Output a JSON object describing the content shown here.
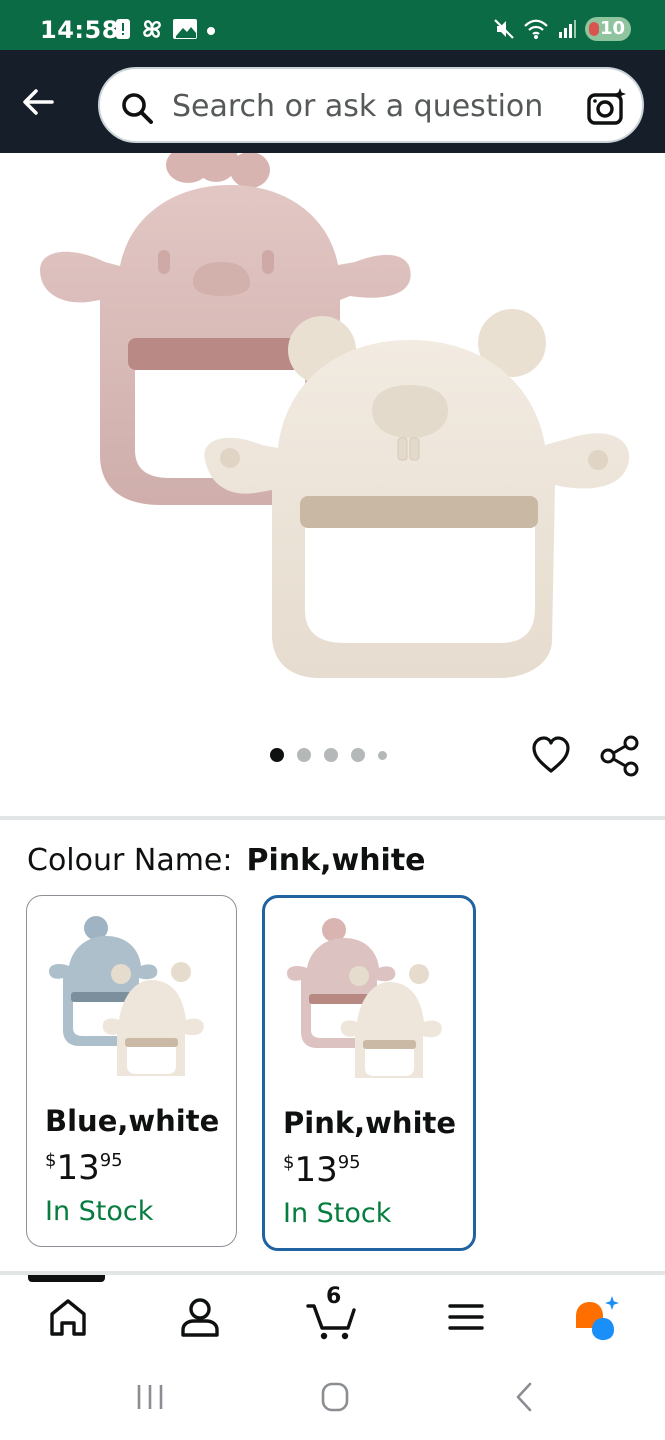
{
  "status_bar": {
    "time": "14:58",
    "battery": "10"
  },
  "search": {
    "placeholder": "Search or ask a question"
  },
  "gallery": {
    "dot_count": 5,
    "active_index": 0
  },
  "variation": {
    "label": "Colour Name:",
    "selected_value": "Pink,white",
    "options": [
      {
        "name": "Blue,white",
        "currency": "$",
        "price_whole": "13",
        "price_fraction": "95",
        "stock": "In Stock",
        "selected": false
      },
      {
        "name": "Pink,white",
        "currency": "$",
        "price_whole": "13",
        "price_fraction": "95",
        "stock": "In Stock",
        "selected": true
      }
    ]
  },
  "bottom_nav": {
    "cart_count": "6",
    "items": [
      "home-icon",
      "account-icon",
      "cart-icon",
      "menu-icon",
      "rufus-icon"
    ]
  },
  "colors": {
    "status_bar": "#0b6b45",
    "header": "#161e2a",
    "in_stock": "#067d3e",
    "selected_border": "#2162a1",
    "pink_teether": "#dcc2c0",
    "white_teether": "#eee6da",
    "blue_teether": "#aebfcc"
  }
}
